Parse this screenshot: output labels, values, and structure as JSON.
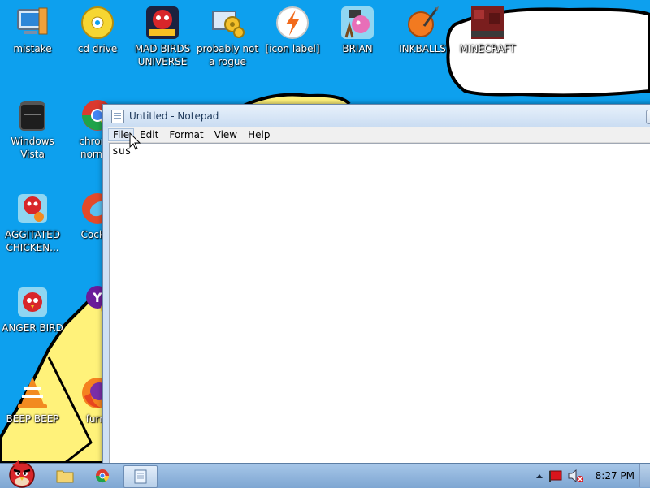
{
  "desktop": {
    "background_color": "#0da0ee",
    "bubble_text": "",
    "icons": [
      {
        "label": "mistake",
        "icon": "monitor-icon"
      },
      {
        "label": "cd drive",
        "icon": "cd-drive-icon"
      },
      {
        "label": "MAD BIRDS UNIVERSE",
        "icon": "angry-birds-space-icon"
      },
      {
        "label": "probably not a rogue",
        "icon": "gear-computer-icon"
      },
      {
        "label": "[icon label]",
        "icon": "flash-icon"
      },
      {
        "label": "BRIAN",
        "icon": "angry-birds-slingshot-icon"
      },
      {
        "label": "INKBALLS",
        "icon": "inkball-icon"
      },
      {
        "label": "MINECRAFT",
        "icon": "minecraft-icon"
      },
      {
        "label": "Windows Vista",
        "icon": "trash-can-icon"
      },
      {
        "label": "chrome normal",
        "icon": "chrome-icon"
      },
      {
        "label": "AGGITATED CHICKEN...",
        "icon": "angry-birds-rio-icon"
      },
      {
        "label": "CockCl",
        "icon": "cockroach-icon"
      },
      {
        "label": "ANGER BIRD",
        "icon": "angry-bird-icon"
      },
      {
        "label": "",
        "icon": "yahoo-icon"
      },
      {
        "label": "BEEP BEEP",
        "icon": "vlc-cone-icon"
      },
      {
        "label": "furry",
        "icon": "firefox-icon"
      }
    ]
  },
  "notepad": {
    "title": "Untitled - Notepad",
    "menu": [
      "File",
      "Edit",
      "Format",
      "View",
      "Help"
    ],
    "content": "sus"
  },
  "taskbar": {
    "start_icon": "angry-bird-start-icon",
    "pinned": [
      "folder-icon",
      "chrome-icon",
      "notepad-icon"
    ],
    "clock": "8:27 PM",
    "tray_icons": [
      "show-hidden-icons-arrow",
      "action-center-flag-icon",
      "volume-muted-icon"
    ]
  }
}
